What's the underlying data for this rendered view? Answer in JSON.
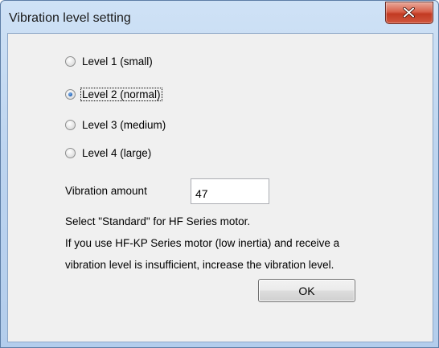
{
  "window": {
    "title": "Vibration level setting",
    "close_icon": "close-x-icon"
  },
  "levels": [
    {
      "label": "Level 1 (small)",
      "checked": false
    },
    {
      "label": "Level 2 (normal)",
      "checked": true
    },
    {
      "label": "Level 3 (medium)",
      "checked": false
    },
    {
      "label": "Level 4 (large)",
      "checked": false
    }
  ],
  "amount": {
    "label": "Vibration amount",
    "value": "47"
  },
  "notes": {
    "line1": "Select \"Standard\" for HF Series motor.",
    "line2": "If you use HF-KP Series motor (low inertia) and receive a",
    "line3": "vibration level is insufficient, increase the vibration level."
  },
  "buttons": {
    "ok": "OK"
  },
  "colors": {
    "titlebar": "#bdd4ef",
    "close_button": "#c9452b",
    "client_bg": "#f0f0f0"
  }
}
